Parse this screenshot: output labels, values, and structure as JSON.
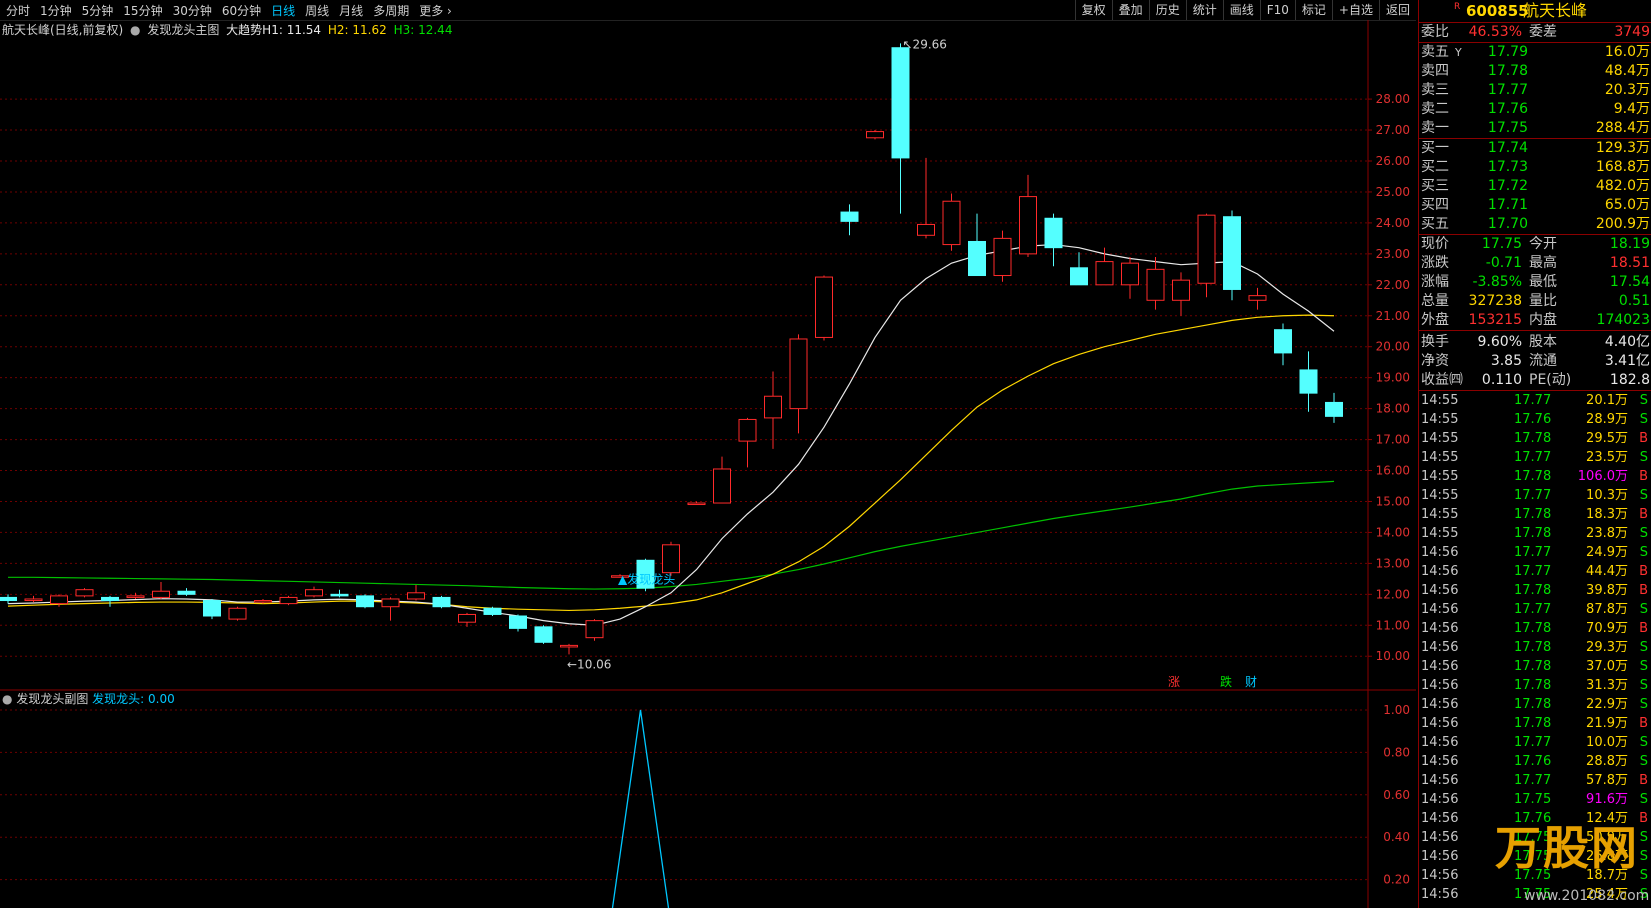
{
  "toolbar": {
    "periods": [
      "分时",
      "1分钟",
      "5分钟",
      "15分钟",
      "30分钟",
      "60分钟",
      "日线",
      "周线",
      "月线",
      "多周期",
      "更多"
    ],
    "active_period": "日线",
    "tools": [
      "复权",
      "叠加",
      "历史",
      "统计",
      "画线",
      "F10",
      "标记",
      "+自选",
      "返回"
    ]
  },
  "main_legend": {
    "stock": "航天长峰(日线,前复权)",
    "indicator": "发现龙头主图",
    "trend_label": "大趋势H1: 11.54",
    "h2": "H2: 11.62",
    "h3": "H3: 12.44"
  },
  "sub_legend": {
    "title": "发现龙头副图",
    "value": "发现龙头: 0.00"
  },
  "annotations": {
    "high": "29.66",
    "low": "10.06",
    "signal": "▲发现龙头",
    "markers": [
      "涨",
      "跌",
      "财"
    ]
  },
  "chart_data": {
    "type": "candlestick",
    "main_axis_ticks": [
      10.0,
      11.0,
      12.0,
      13.0,
      14.0,
      15.0,
      16.0,
      17.0,
      18.0,
      19.0,
      20.0,
      21.0,
      22.0,
      23.0,
      24.0,
      25.0,
      26.0,
      27.0,
      28.0
    ],
    "sub_axis_ticks": [
      0.2,
      0.4,
      0.6,
      0.8,
      1.0
    ],
    "candles": [
      {
        "o": 11.9,
        "c": 11.8,
        "h": 12.0,
        "l": 11.7
      },
      {
        "o": 11.8,
        "c": 11.85,
        "h": 11.95,
        "l": 11.75
      },
      {
        "o": 11.7,
        "c": 11.95,
        "h": 12.0,
        "l": 11.6
      },
      {
        "o": 11.95,
        "c": 12.15,
        "h": 12.2,
        "l": 11.9
      },
      {
        "o": 11.9,
        "c": 11.8,
        "h": 11.95,
        "l": 11.6
      },
      {
        "o": 11.9,
        "c": 11.95,
        "h": 12.05,
        "l": 11.85
      },
      {
        "o": 11.9,
        "c": 12.1,
        "h": 12.4,
        "l": 11.85
      },
      {
        "o": 12.1,
        "c": 12.0,
        "h": 12.2,
        "l": 11.95
      },
      {
        "o": 11.8,
        "c": 11.3,
        "h": 11.85,
        "l": 11.2
      },
      {
        "o": 11.2,
        "c": 11.55,
        "h": 11.6,
        "l": 11.15
      },
      {
        "o": 11.8,
        "c": 11.8,
        "h": 11.85,
        "l": 11.7
      },
      {
        "o": 11.7,
        "c": 11.9,
        "h": 11.95,
        "l": 11.65
      },
      {
        "o": 11.95,
        "c": 12.15,
        "h": 12.25,
        "l": 11.9
      },
      {
        "o": 12.0,
        "c": 11.95,
        "h": 12.15,
        "l": 11.9
      },
      {
        "o": 11.95,
        "c": 11.6,
        "h": 12.0,
        "l": 11.55
      },
      {
        "o": 11.6,
        "c": 11.85,
        "h": 11.9,
        "l": 11.15
      },
      {
        "o": 11.85,
        "c": 12.05,
        "h": 12.3,
        "l": 11.8
      },
      {
        "o": 11.9,
        "c": 11.6,
        "h": 11.95,
        "l": 11.55
      },
      {
        "o": 11.1,
        "c": 11.35,
        "h": 11.4,
        "l": 10.95
      },
      {
        "o": 11.55,
        "c": 11.35,
        "h": 11.6,
        "l": 11.3
      },
      {
        "o": 11.3,
        "c": 10.9,
        "h": 11.35,
        "l": 10.8
      },
      {
        "o": 10.95,
        "c": 10.45,
        "h": 11.0,
        "l": 10.4
      },
      {
        "o": 10.3,
        "c": 10.35,
        "h": 10.4,
        "l": 10.06
      },
      {
        "o": 10.6,
        "c": 11.15,
        "h": 11.2,
        "l": 10.5
      },
      {
        "o": 12.6,
        "c": 12.6,
        "h": 12.65,
        "l": 12.55
      },
      {
        "o": 13.1,
        "c": 12.2,
        "h": 13.15,
        "l": 12.1
      },
      {
        "o": 12.7,
        "c": 13.6,
        "h": 13.7,
        "l": 12.6
      },
      {
        "o": 14.95,
        "c": 14.95,
        "h": 15.0,
        "l": 14.9
      },
      {
        "o": 14.95,
        "c": 16.05,
        "h": 16.45,
        "l": 14.95
      },
      {
        "o": 16.95,
        "c": 17.65,
        "h": 17.7,
        "l": 16.1
      },
      {
        "o": 17.7,
        "c": 18.4,
        "h": 19.2,
        "l": 16.7
      },
      {
        "o": 18.0,
        "c": 20.25,
        "h": 20.4,
        "l": 17.2
      },
      {
        "o": 20.3,
        "c": 22.25,
        "h": 22.3,
        "l": 20.2
      },
      {
        "o": 24.35,
        "c": 24.05,
        "h": 24.6,
        "l": 23.6
      },
      {
        "o": 26.75,
        "c": 26.95,
        "h": 27.0,
        "l": 26.7
      },
      {
        "o": 29.66,
        "c": 26.1,
        "h": 29.8,
        "l": 24.3
      },
      {
        "o": 23.6,
        "c": 23.95,
        "h": 26.1,
        "l": 23.5
      },
      {
        "o": 23.3,
        "c": 24.7,
        "h": 24.95,
        "l": 23.1
      },
      {
        "o": 23.4,
        "c": 22.3,
        "h": 24.3,
        "l": 22.3
      },
      {
        "o": 22.3,
        "c": 23.5,
        "h": 23.75,
        "l": 22.1
      },
      {
        "o": 23.0,
        "c": 24.85,
        "h": 25.55,
        "l": 22.9
      },
      {
        "o": 24.15,
        "c": 23.2,
        "h": 24.3,
        "l": 22.6
      },
      {
        "o": 22.55,
        "c": 22.0,
        "h": 23.05,
        "l": 22.0
      },
      {
        "o": 22.0,
        "c": 22.75,
        "h": 23.2,
        "l": 22.0
      },
      {
        "o": 22.0,
        "c": 22.7,
        "h": 22.9,
        "l": 21.55
      },
      {
        "o": 21.5,
        "c": 22.5,
        "h": 22.9,
        "l": 21.2
      },
      {
        "o": 21.5,
        "c": 22.15,
        "h": 22.4,
        "l": 21.0
      },
      {
        "o": 22.05,
        "c": 24.25,
        "h": 24.3,
        "l": 21.6
      },
      {
        "o": 24.2,
        "c": 21.85,
        "h": 24.4,
        "l": 21.5
      },
      {
        "o": 21.5,
        "c": 21.65,
        "h": 21.9,
        "l": 21.2
      },
      {
        "o": 20.55,
        "c": 19.8,
        "h": 20.75,
        "l": 19.4
      },
      {
        "o": 19.25,
        "c": 18.5,
        "h": 19.85,
        "l": 17.9
      },
      {
        "o": 18.2,
        "c": 17.75,
        "h": 18.51,
        "l": 17.54
      }
    ],
    "ma_white": [
      11.7,
      11.72,
      11.75,
      11.78,
      11.8,
      11.83,
      11.86,
      11.85,
      11.82,
      11.75,
      11.75,
      11.78,
      11.82,
      11.84,
      11.82,
      11.78,
      11.75,
      11.68,
      11.55,
      11.42,
      11.3,
      11.15,
      11.05,
      11.0,
      11.2,
      11.6,
      12.05,
      12.8,
      13.8,
      14.6,
      15.3,
      16.2,
      17.4,
      18.8,
      20.3,
      21.5,
      22.2,
      22.7,
      22.95,
      23.1,
      23.25,
      23.3,
      23.2,
      23.0,
      22.85,
      22.75,
      22.65,
      22.7,
      22.75,
      22.35,
      21.7,
      21.15,
      20.5
    ],
    "ma_yellow": [
      11.62,
      11.65,
      11.68,
      11.7,
      11.72,
      11.74,
      11.75,
      11.75,
      11.74,
      11.72,
      11.7,
      11.72,
      11.75,
      11.78,
      11.78,
      11.75,
      11.72,
      11.68,
      11.6,
      11.55,
      11.52,
      11.5,
      11.48,
      11.5,
      11.55,
      11.62,
      11.7,
      11.82,
      12.05,
      12.35,
      12.65,
      13.05,
      13.55,
      14.2,
      14.95,
      15.7,
      16.5,
      17.3,
      18.05,
      18.6,
      19.05,
      19.45,
      19.75,
      20.0,
      20.2,
      20.4,
      20.55,
      20.7,
      20.85,
      20.95,
      21.0,
      21.02,
      21.0
    ],
    "ma_green": [
      12.55,
      12.55,
      12.54,
      12.53,
      12.52,
      12.51,
      12.5,
      12.49,
      12.48,
      12.46,
      12.44,
      12.42,
      12.4,
      12.38,
      12.36,
      12.34,
      12.32,
      12.3,
      12.28,
      12.25,
      12.22,
      12.2,
      12.18,
      12.17,
      12.18,
      12.2,
      12.25,
      12.32,
      12.42,
      12.52,
      12.65,
      12.8,
      12.98,
      13.18,
      13.38,
      13.55,
      13.7,
      13.85,
      14.0,
      14.15,
      14.3,
      14.45,
      14.58,
      14.7,
      14.82,
      14.95,
      15.08,
      15.25,
      15.4,
      15.5,
      15.55,
      15.6,
      15.65
    ],
    "sub_series": {
      "name": "发现龙头",
      "peak_index": 25,
      "peak_value": 1.0,
      "last_value": 0.0
    }
  },
  "quote": {
    "mark": "R",
    "code": "600855",
    "name": "航天长峰",
    "weibi_label": "委比",
    "weibi_value": "46.53%",
    "weicha_label": "委差",
    "weicha_value": "3749",
    "asks": [
      {
        "label": "卖五",
        "price": "17.79",
        "vol": "16.0万",
        "flag": "Y"
      },
      {
        "label": "卖四",
        "price": "17.78",
        "vol": "48.4万",
        "flag": ""
      },
      {
        "label": "卖三",
        "price": "17.77",
        "vol": "20.3万",
        "flag": ""
      },
      {
        "label": "卖二",
        "price": "17.76",
        "vol": "9.4万",
        "flag": ""
      },
      {
        "label": "卖一",
        "price": "17.75",
        "vol": "288.4万",
        "flag": ""
      }
    ],
    "bids": [
      {
        "label": "买一",
        "price": "17.74",
        "vol": "129.3万"
      },
      {
        "label": "买二",
        "price": "17.73",
        "vol": "168.8万"
      },
      {
        "label": "买三",
        "price": "17.72",
        "vol": "482.0万"
      },
      {
        "label": "买四",
        "price": "17.71",
        "vol": "65.0万"
      },
      {
        "label": "买五",
        "price": "17.70",
        "vol": "200.9万"
      }
    ],
    "stats": [
      {
        "l1": "现价",
        "v1": "17.75",
        "c1": "green",
        "l2": "今开",
        "v2": "18.19",
        "c2": "green"
      },
      {
        "l1": "涨跌",
        "v1": "-0.71",
        "c1": "green",
        "l2": "最高",
        "v2": "18.51",
        "c2": "red"
      },
      {
        "l1": "涨幅",
        "v1": "-3.85%",
        "c1": "green",
        "l2": "最低",
        "v2": "17.54",
        "c2": "green"
      },
      {
        "l1": "总量",
        "v1": "327238",
        "c1": "yellow",
        "l2": "量比",
        "v2": "0.51",
        "c2": "green"
      },
      {
        "l1": "外盘",
        "v1": "153215",
        "c1": "red",
        "l2": "内盘",
        "v2": "174023",
        "c2": "green"
      }
    ],
    "stats2": [
      {
        "l1": "换手",
        "v1": "9.60%",
        "c1": "white",
        "l2": "股本",
        "v2": "4.40亿",
        "c2": "white"
      },
      {
        "l1": "净资",
        "v1": "3.85",
        "c1": "white",
        "l2": "流通",
        "v2": "3.41亿",
        "c2": "white"
      },
      {
        "l1": "收益㈣",
        "v1": "0.110",
        "c1": "white",
        "l2": "PE(动)",
        "v2": "182.8",
        "c2": "white"
      }
    ]
  },
  "ticks": [
    {
      "t": "14:55",
      "p": "17.77",
      "v": "20.1万",
      "s": "S"
    },
    {
      "t": "14:55",
      "p": "17.76",
      "v": "28.9万",
      "s": "S"
    },
    {
      "t": "14:55",
      "p": "17.78",
      "v": "29.5万",
      "s": "B"
    },
    {
      "t": "14:55",
      "p": "17.77",
      "v": "23.5万",
      "s": "S"
    },
    {
      "t": "14:55",
      "p": "17.78",
      "v": "106.0万",
      "s": "B",
      "big": true
    },
    {
      "t": "14:55",
      "p": "17.77",
      "v": "10.3万",
      "s": "S"
    },
    {
      "t": "14:55",
      "p": "17.78",
      "v": "18.3万",
      "s": "B"
    },
    {
      "t": "14:55",
      "p": "17.78",
      "v": "23.8万",
      "s": "S"
    },
    {
      "t": "14:56",
      "p": "17.77",
      "v": "24.9万",
      "s": "S"
    },
    {
      "t": "14:56",
      "p": "17.77",
      "v": "44.4万",
      "s": "B"
    },
    {
      "t": "14:56",
      "p": "17.78",
      "v": "39.8万",
      "s": "B"
    },
    {
      "t": "14:56",
      "p": "17.77",
      "v": "87.8万",
      "s": "S"
    },
    {
      "t": "14:56",
      "p": "17.78",
      "v": "70.9万",
      "s": "B"
    },
    {
      "t": "14:56",
      "p": "17.78",
      "v": "29.3万",
      "s": "S"
    },
    {
      "t": "14:56",
      "p": "17.78",
      "v": "37.0万",
      "s": "S"
    },
    {
      "t": "14:56",
      "p": "17.78",
      "v": "31.3万",
      "s": "S"
    },
    {
      "t": "14:56",
      "p": "17.78",
      "v": "22.9万",
      "s": "S"
    },
    {
      "t": "14:56",
      "p": "17.78",
      "v": "21.9万",
      "s": "B"
    },
    {
      "t": "14:56",
      "p": "17.77",
      "v": "10.0万",
      "s": "S"
    },
    {
      "t": "14:56",
      "p": "17.76",
      "v": "28.8万",
      "s": "S"
    },
    {
      "t": "14:56",
      "p": "17.77",
      "v": "57.8万",
      "s": "B"
    },
    {
      "t": "14:56",
      "p": "17.75",
      "v": "91.6万",
      "s": "S",
      "big": true
    },
    {
      "t": "14:56",
      "p": "17.76",
      "v": "12.4万",
      "s": "B"
    },
    {
      "t": "14:56",
      "p": "17.75",
      "v": "50.9万",
      "s": "S"
    },
    {
      "t": "14:56",
      "p": "17.75",
      "v": "26.8万",
      "s": "S"
    },
    {
      "t": "14:56",
      "p": "17.75",
      "v": "18.7万",
      "s": "S"
    },
    {
      "t": "14:56",
      "p": "17.75",
      "v": "25.4万",
      "s": "S"
    }
  ],
  "watermark": {
    "text": "万股网",
    "url": "www.201082.com"
  }
}
